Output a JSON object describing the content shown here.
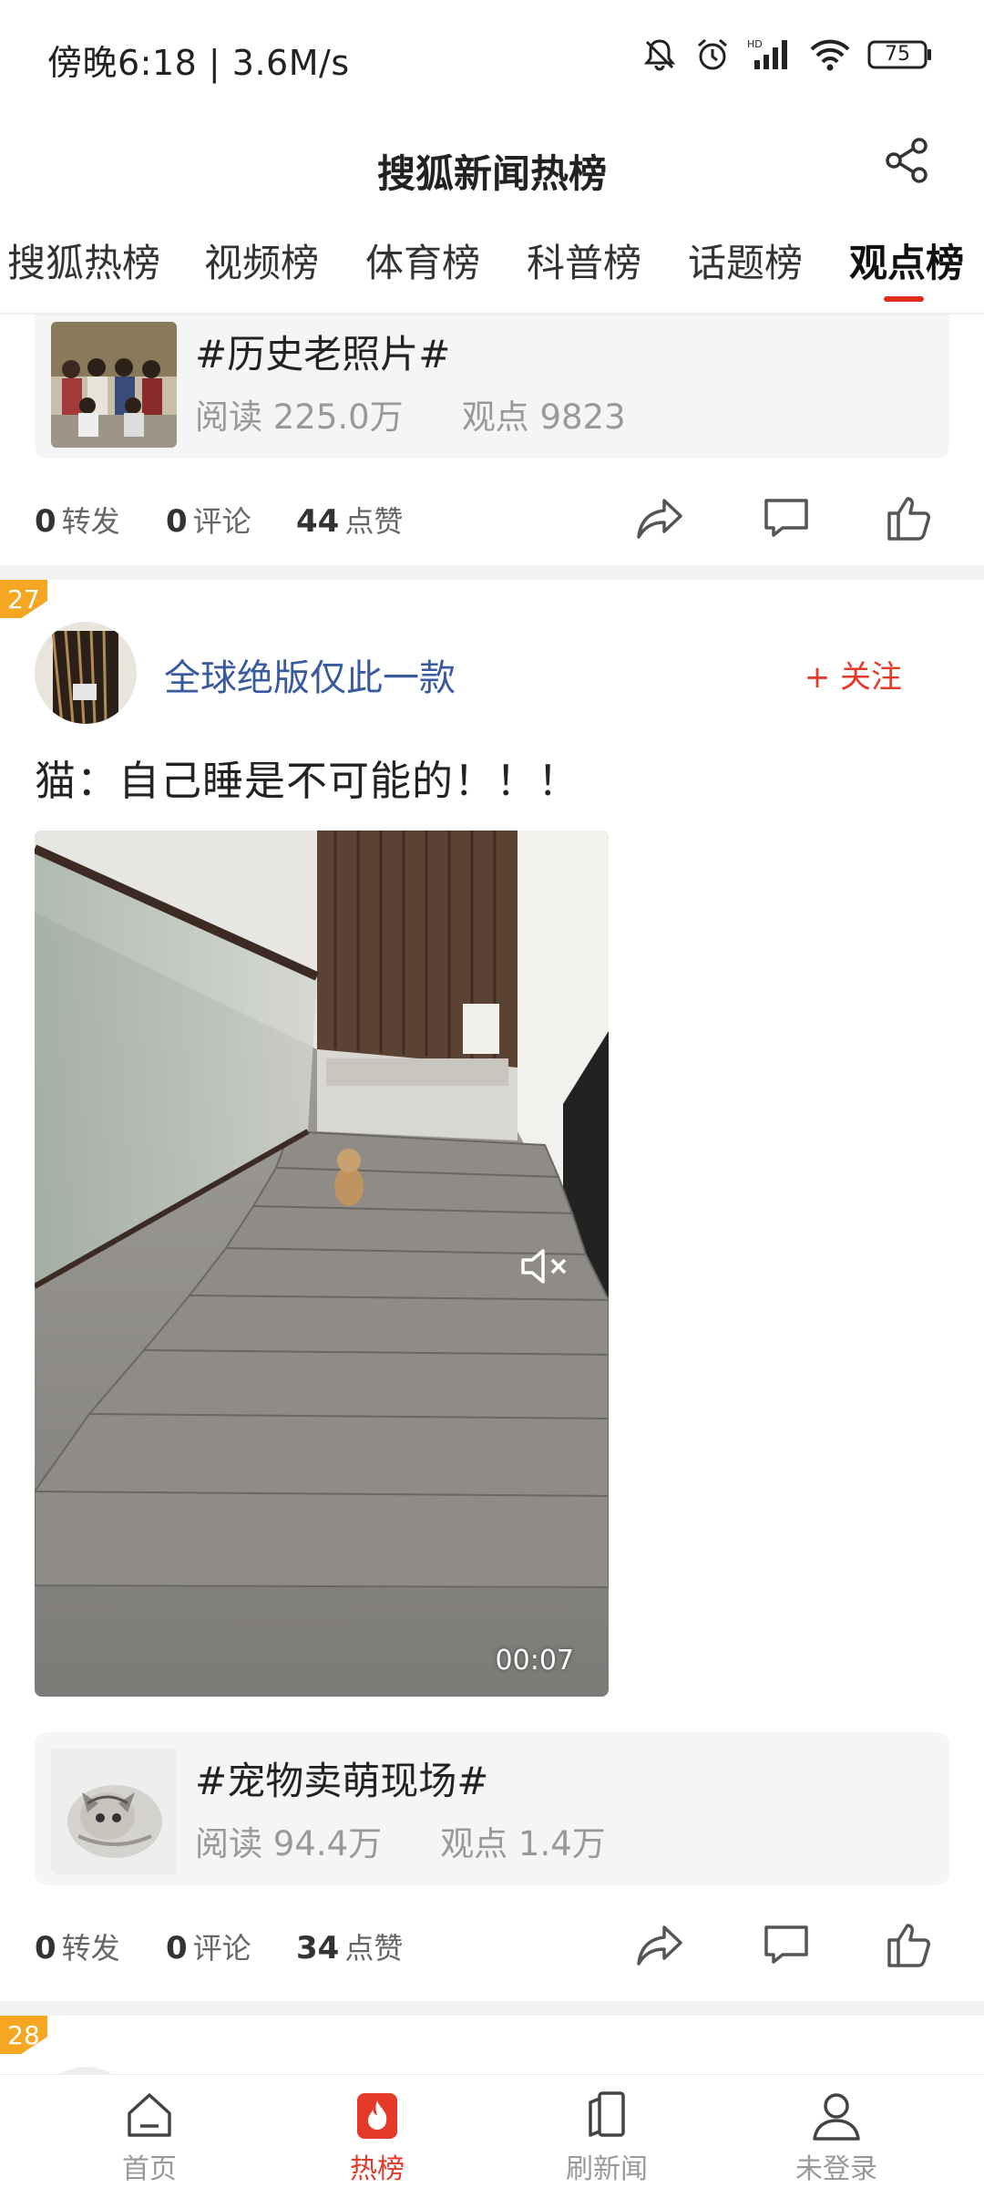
{
  "status_bar": {
    "time": "傍晚6:18 | 3.6M/s",
    "battery": "75"
  },
  "header": {
    "title": "搜狐新闻热榜"
  },
  "tabs": [
    {
      "label": "搜狐热榜",
      "active": false
    },
    {
      "label": "视频榜",
      "active": false
    },
    {
      "label": "体育榜",
      "active": false
    },
    {
      "label": "科普榜",
      "active": false
    },
    {
      "label": "话题榜",
      "active": false
    },
    {
      "label": "观点榜",
      "active": true
    }
  ],
  "colors": {
    "accent": "#e53a2a",
    "rank_badge": "#f5a623",
    "author": "#3a5a9e"
  },
  "items": [
    {
      "topic": {
        "title": "#历史老照片#",
        "reads": "阅读 225.0万",
        "views": "观点 9823"
      },
      "actions": {
        "reposts_count": "0",
        "reposts_label": "转发",
        "comments_count": "0",
        "comments_label": "评论",
        "likes_count": "44",
        "likes_label": "点赞"
      }
    },
    {
      "rank": "27",
      "author": "全球绝版仅此一款",
      "follow": "+ 关注",
      "text": "猫：自己睡是不可能的！！！",
      "video_duration": "00:07",
      "topic": {
        "title": "#宠物卖萌现场#",
        "reads": "阅读 94.4万",
        "views": "观点 1.4万"
      },
      "actions": {
        "reposts_count": "0",
        "reposts_label": "转发",
        "comments_count": "0",
        "comments_label": "评论",
        "likes_count": "34",
        "likes_label": "点赞"
      }
    },
    {
      "rank": "28"
    }
  ],
  "bottom_nav": [
    {
      "label": "首页",
      "icon": "home-icon",
      "active": false
    },
    {
      "label": "热榜",
      "icon": "hot-icon",
      "active": true
    },
    {
      "label": "刷新闻",
      "icon": "refresh-news-icon",
      "active": false
    },
    {
      "label": "未登录",
      "icon": "user-icon",
      "active": false
    }
  ]
}
